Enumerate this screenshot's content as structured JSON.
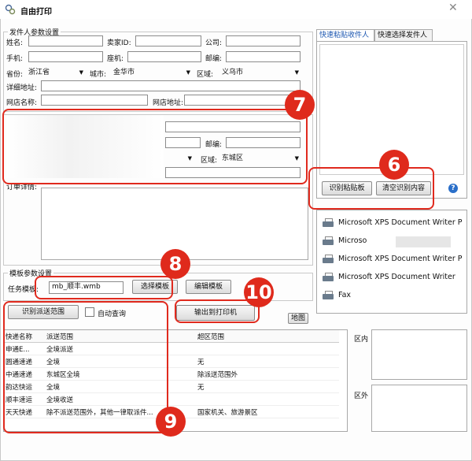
{
  "window": {
    "title": "自由打印"
  },
  "sender": {
    "group_label": "发件人参数设置",
    "name_label": "姓名:",
    "seller_id_label": "卖家ID:",
    "company_label": "公司:",
    "mobile_label": "手机:",
    "landline_label": "座机:",
    "postcode_label": "邮编:",
    "province_label": "省份:",
    "province_value": "浙江省",
    "city_label": "城市:",
    "city_value": "金华市",
    "district_label": "区域:",
    "district_value": "义乌市",
    "address_label": "详细地址:",
    "shop_name_label": "网店名称:",
    "shop_url_label": "网店地址:"
  },
  "receiver": {
    "postcode_label": "邮编:",
    "district_label": "区域:",
    "district_value": "东城区",
    "detail_label": "订单详情:"
  },
  "template": {
    "group_label": "模板参数设置",
    "task_label": "任务模板:",
    "task_value": "mb_顺丰.wmb",
    "select_button": "选择模板",
    "edit_button": "编辑模板"
  },
  "actions": {
    "identify_range_button": "识别派送范围",
    "auto_query_label": "自动查询",
    "print_button": "输出到打印机",
    "map_button": "地图"
  },
  "range_table": {
    "headers": [
      "快递名称",
      "派送范围",
      "超区范围"
    ],
    "rows": [
      [
        "申通E...",
        "全境派送",
        ""
      ],
      [
        "圆通速递",
        "全境",
        "无"
      ],
      [
        "中通速递",
        "东城区全境",
        "除派送范围外"
      ],
      [
        "韵达快运",
        "全境",
        "无"
      ],
      [
        "顺丰速运",
        "全境收送",
        ""
      ],
      [
        "天天快递",
        "除不派送范围外，其他一律取派件...",
        "国家机关、旅游景区"
      ]
    ]
  },
  "region": {
    "inside_label": "区内",
    "outside_label": "区外"
  },
  "right_tabs": [
    "快速粘贴收件人",
    "快速选择发件人"
  ],
  "clipboard": {
    "identify_button": "识别粘贴板",
    "clear_button": "清空识别内容",
    "help_icon_text": "?"
  },
  "printers": [
    "Microsoft XPS Document Writer P",
    "Microso",
    "Microsoft XPS Document Writer P",
    "Microsoft XPS Document Writer",
    "Fax"
  ],
  "badges": [
    "7",
    "6",
    "8",
    "10",
    "9"
  ],
  "colors": {
    "annotation_red": "#df2a1c",
    "active_tab_text": "#1a55b0"
  }
}
